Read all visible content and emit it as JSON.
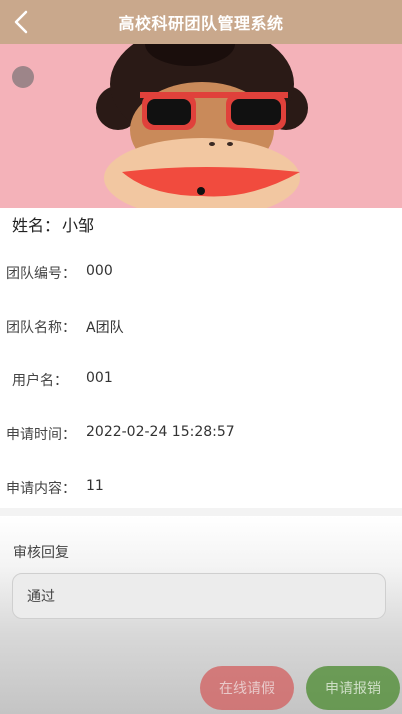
{
  "header": {
    "title": "高校科研团队管理系统",
    "back_icon": "chevron-left-icon"
  },
  "profile": {
    "name_label": "姓名：",
    "name_value": "小邹"
  },
  "info": [
    {
      "label": "团队编号：",
      "value": "000"
    },
    {
      "label": "团队名称：",
      "value": "A团队"
    },
    {
      "label": "用户名：",
      "value": "001"
    },
    {
      "label": "申请时间：",
      "value": "2022-02-24 15:28:57"
    },
    {
      "label": "申请内容：",
      "value": "11"
    }
  ],
  "review": {
    "label": "审核回复",
    "value": "通过"
  },
  "actions": {
    "leave": "在线请假",
    "reimburse": "申请报销"
  },
  "colors": {
    "header": "#c9a88c",
    "leave_button": "#d35e5e",
    "reimburse_button": "#4a8a2e"
  }
}
